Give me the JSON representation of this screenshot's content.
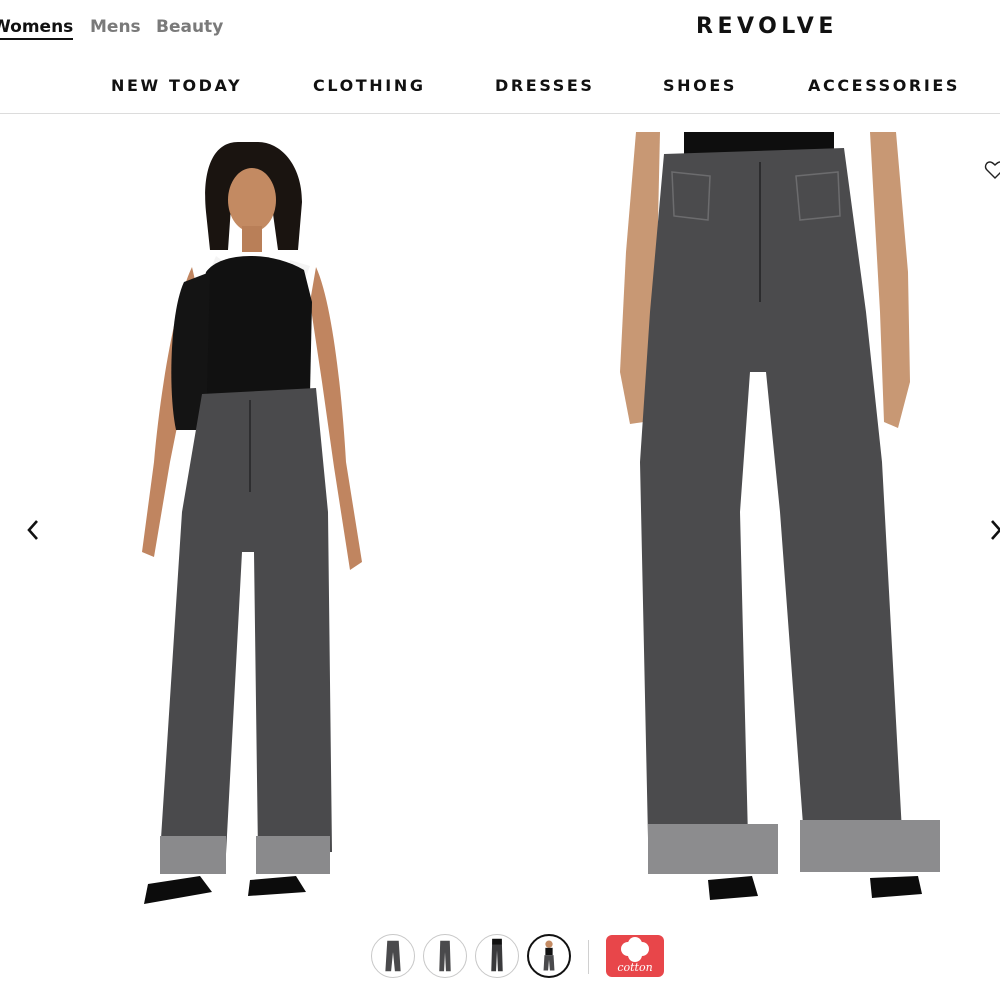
{
  "header": {
    "departments": [
      {
        "label": "Womens",
        "active": true
      },
      {
        "label": "Mens",
        "active": false
      },
      {
        "label": "Beauty",
        "active": false
      }
    ],
    "logo": "REVOLVE"
  },
  "nav": {
    "items": [
      "NEW TODAY",
      "CLOTHING",
      "DRESSES",
      "SHOES",
      "ACCESSORIES"
    ]
  },
  "gallery": {
    "prev_icon": "chevron-left-icon",
    "next_icon": "chevron-right-icon",
    "wishlist_icon": "heart-outline-icon",
    "thumbnails_count": 4,
    "active_thumbnail": 4
  },
  "badge": {
    "text": "cotton",
    "color": "#e8464a"
  },
  "colors": {
    "denim": "#4a4a4c",
    "text": "#111111",
    "muted": "#7a7a7a"
  }
}
